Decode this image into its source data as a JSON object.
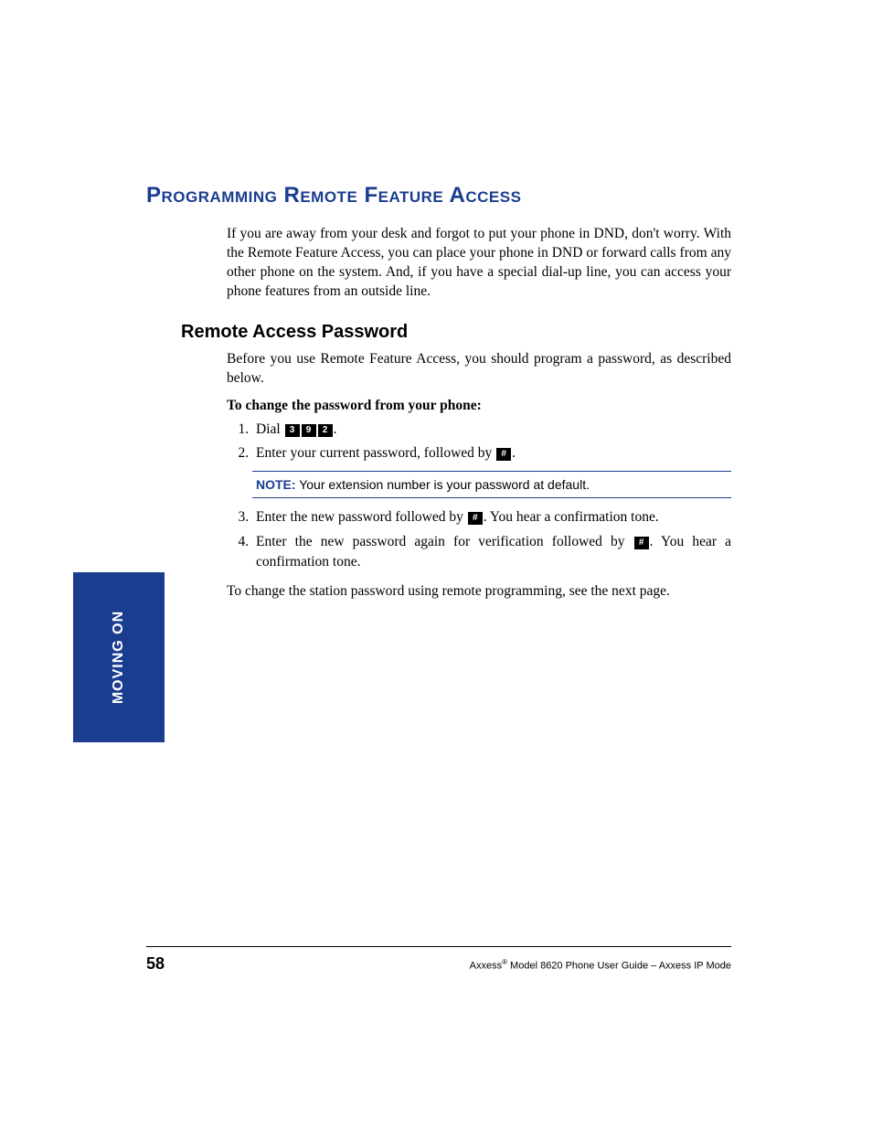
{
  "section": {
    "title": "Programming Remote Feature Access",
    "intro": "If you are away from your desk and forgot to put your phone in DND, don't worry. With the Remote Feature Access, you can place your phone in DND or forward calls from any other phone on the system. And, if you have a special dial-up line, you can access your phone features from an outside line."
  },
  "subsection": {
    "title": "Remote Access Password",
    "intro": "Before you use Remote Feature Access, you should program a password, as described below.",
    "procedure_title": "To change the password from your phone:",
    "step1_prefix": "Dial ",
    "step1_suffix": ".",
    "key1": "3",
    "key2": "9",
    "key3": "2",
    "step2_prefix": "Enter your current password, followed by ",
    "step2_suffix": ".",
    "pound_key": "#",
    "note_label": "NOTE:",
    "note_text": " Your extension number is your password at default.",
    "step3_prefix": "Enter the new password followed by ",
    "step3_suffix": ". You hear a confirmation tone.",
    "step4_prefix": "Enter the new password again for verification followed by ",
    "step4_suffix": ". You hear a confirmation tone.",
    "closing": "To change the station password using remote programming, see the next page."
  },
  "side_tab": "MOVING ON",
  "footer": {
    "page_number": "58",
    "brand": "Axxess",
    "rest": " Model 8620 Phone User Guide – Axxess IP Mode",
    "reg": "®"
  }
}
